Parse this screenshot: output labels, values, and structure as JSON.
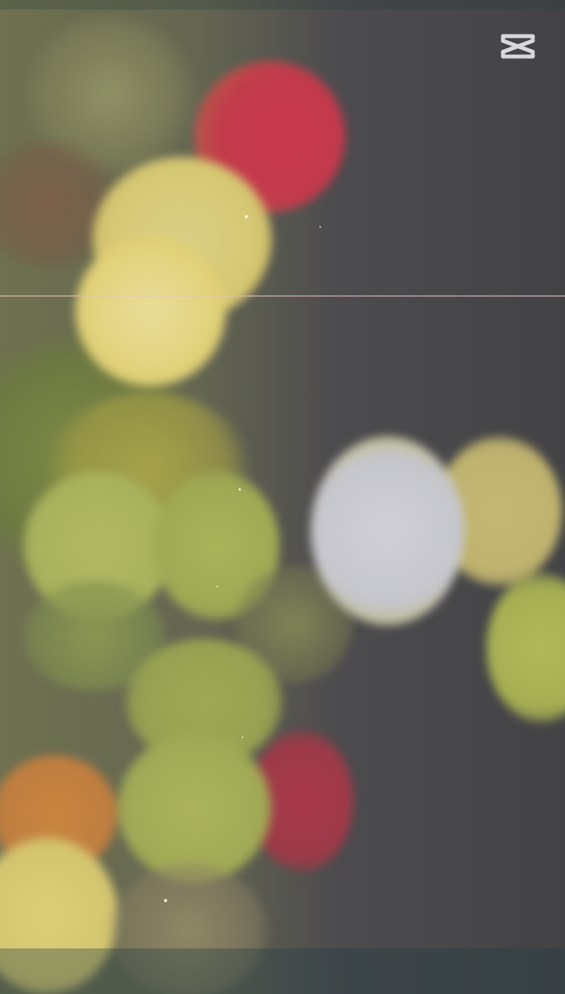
{
  "scene": {
    "description_tag": "bokeh-lights-video-frame",
    "palette": {
      "background": "#4a4a4c",
      "red": "#c9384f",
      "yellow": "#e3d27a",
      "green": "#a8b35a",
      "white": "#c9c9cf",
      "orange": "#c8803e"
    }
  },
  "overlay": {
    "logo_icon": "capcut-logo-icon"
  }
}
